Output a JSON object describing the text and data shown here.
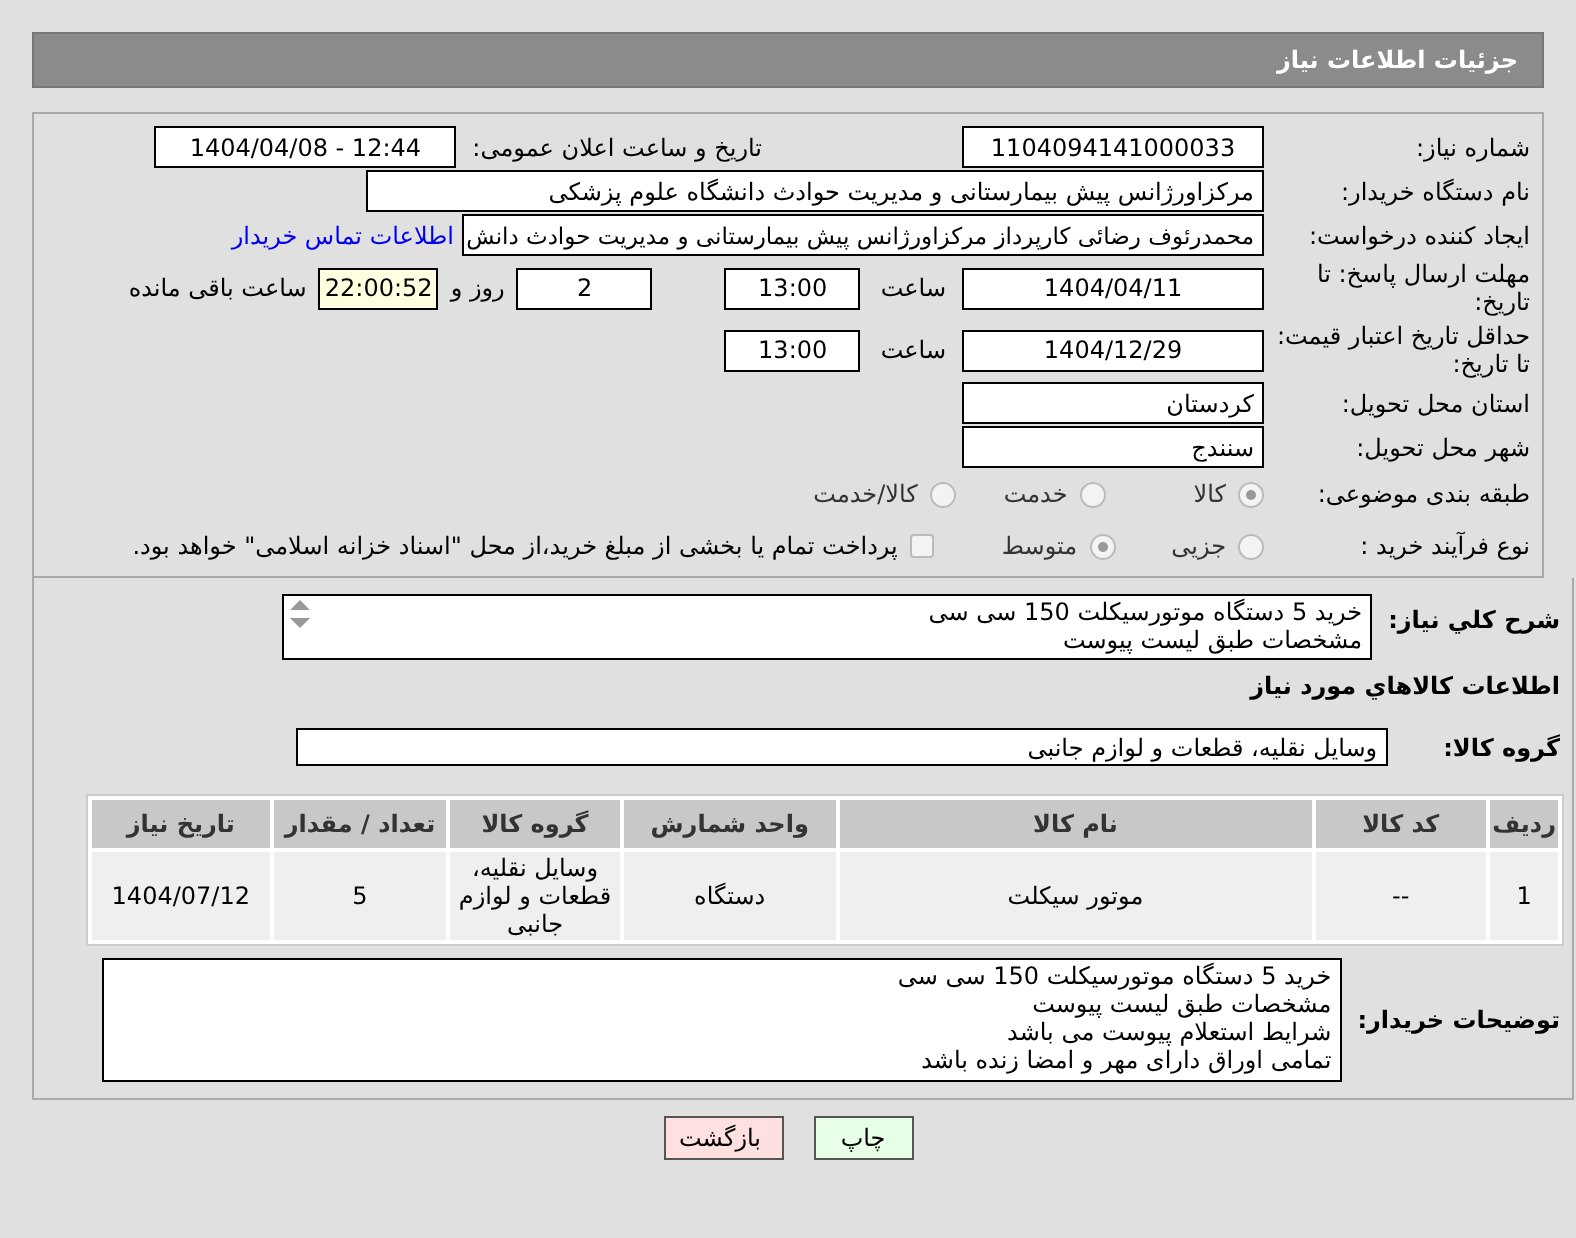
{
  "header": {
    "title": "جزئیات اطلاعات نیاز"
  },
  "details": {
    "need_number": {
      "label": "شماره نیاز:",
      "value": "1104094141000033"
    },
    "announce": {
      "label": "تاریخ و ساعت اعلان عمومی:",
      "value": "1404/04/08 - 12:44"
    },
    "buyer_org": {
      "label": "نام دستگاه خریدار:",
      "value": "مرکزاورژانس پیش بیمارستانی و مدیریت حوادث دانشگاه علوم پزشکی"
    },
    "creator": {
      "label": "ایجاد کننده درخواست:",
      "value": "محمدرئوف رضائی کارپرداز مرکزاورژانس پیش بیمارستانی و مدیریت حوادث دانش",
      "link": "اطلاعات تماس خریدار"
    },
    "reply_deadline": {
      "label": "مهلت ارسال پاسخ: تا تاریخ:",
      "date": "1404/04/11",
      "time_label": "ساعت",
      "time": "13:00",
      "days": "2",
      "days_label": "روز و",
      "remaining": "22:00:52",
      "remaining_label": "ساعت باقی مانده"
    },
    "price_validity": {
      "label": "حداقل تاریخ اعتبار قیمت: تا تاریخ:",
      "date": "1404/12/29",
      "time_label": "ساعت",
      "time": "13:00"
    },
    "province": {
      "label": "استان محل تحویل:",
      "value": "کردستان"
    },
    "city": {
      "label": "شهر محل تحویل:",
      "value": "سنندج"
    },
    "category": {
      "label": "طبقه بندی موضوعی:",
      "options": [
        {
          "label": "کالا",
          "selected": true
        },
        {
          "label": "خدمت",
          "selected": false
        },
        {
          "label": "کالا/خدمت",
          "selected": false
        }
      ]
    },
    "purchase_type": {
      "label": "نوع فرآیند خرید :",
      "options": [
        {
          "label": "جزیی",
          "selected": false
        },
        {
          "label": "متوسط",
          "selected": true
        }
      ],
      "payment_note": {
        "label": "پرداخت تمام یا بخشی از مبلغ خرید،از محل \"اسناد خزانه اسلامی\" خواهد بود.",
        "checked": false
      }
    }
  },
  "goods": {
    "summary": {
      "label": "شرح کلي نیاز:",
      "lines": [
        "خرید 5 دستگاه موتورسیکلت 150 سی سی",
        "مشخصات طبق لیست پیوست"
      ]
    },
    "heading": "اطلاعات کالاهاي مورد نياز",
    "group": {
      "label": "گروه کالا:",
      "value": "وسایل نقلیه، قطعات و لوازم جانبی"
    },
    "table": {
      "columns": [
        "ردیف",
        "کد کالا",
        "نام کالا",
        "واحد شمارش",
        "گروه کالا",
        "تعداد / مقدار",
        "تاریخ نیاز"
      ],
      "rows": [
        [
          "1",
          "--",
          "موتور سیکلت",
          "دستگاه",
          "وسایل نقلیه، قطعات و لوازم جانبی",
          "5",
          "1404/07/12"
        ]
      ]
    },
    "buyer_notes": {
      "label": "توضیحات خریدار:",
      "lines": [
        "خرید 5 دستگاه موتورسیکلت 150 سی سی",
        "مشخصات طبق لیست پیوست",
        "شرایط استعلام پیوست می باشد",
        "تمامی اوراق دارای مهر و امضا زنده باشد"
      ]
    }
  },
  "buttons": [
    {
      "kind": "print",
      "label": "چاپ"
    },
    {
      "kind": "back",
      "label": "بازگشت"
    }
  ]
}
